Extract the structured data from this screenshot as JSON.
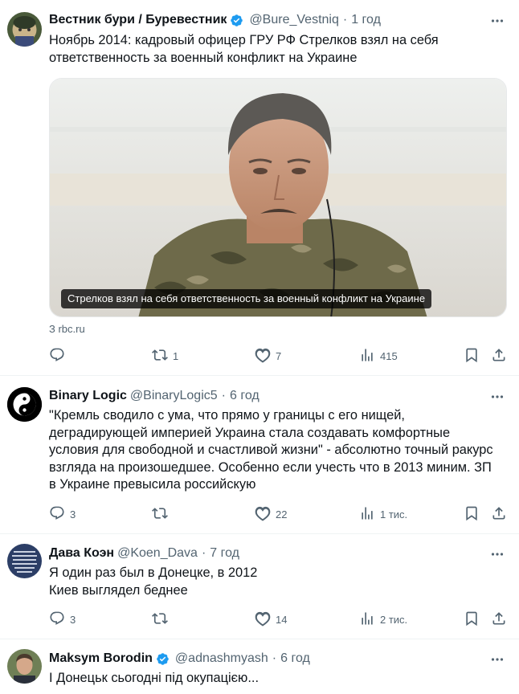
{
  "tweets": [
    {
      "name": "Вестник бури / Буревестник",
      "handle": "@Bure_Vestniq",
      "sep": "·",
      "time": "1 год",
      "text": "Ноябрь 2014: кадровый офицер ГРУ РФ Стрелков взял на себя ответственность за военный конфликт на Украине",
      "card": {
        "caption": "Стрелков взял на себя ответственность за военный конфликт на Украине",
        "source": "З rbc.ru"
      },
      "replies": "",
      "retweets": "1",
      "likes": "7",
      "views": "415"
    },
    {
      "name": "Binary Logic",
      "handle": "@BinaryLogic5",
      "sep": "·",
      "time": "6 год",
      "text": "\"Кремль сводило с ума, что прямо у границы с его нищей, деградирующей империей Украина стала создавать комфортные условия для свободной и счастливой жизни\" - абсолютно точный ракурс взгляда на произошедшее. Особенно если учесть что в 2013 миним. ЗП в Украине превысила российскую",
      "replies": "3",
      "retweets": "",
      "likes": "22",
      "views": "1 тис."
    },
    {
      "name": "Дава Коэн",
      "handle": "@Koen_Dava",
      "sep": "·",
      "time": "7 год",
      "text": "Я один раз был в Донецке, в 2012\nКиев выглядел беднее",
      "replies": "3",
      "retweets": "",
      "likes": "14",
      "views": "2 тис."
    },
    {
      "name": "Maksym Borodin",
      "handle": "@adnashmyash",
      "sep": "·",
      "time": "6 год",
      "text": "І Донецьк сьогодні під окупацією..."
    }
  ],
  "icons": {
    "verified_color": "#1d9bf0",
    "action_color": "#536471"
  }
}
